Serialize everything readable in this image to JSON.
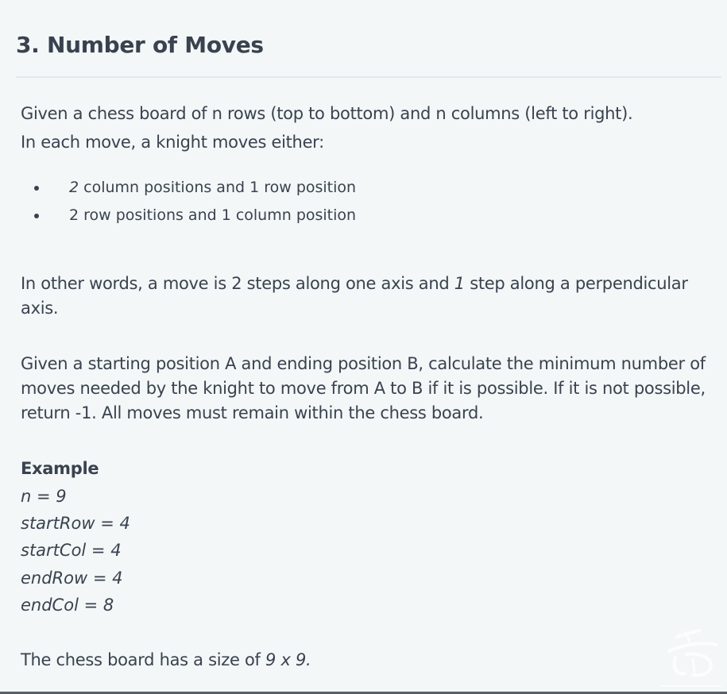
{
  "title": "3. Number of Moves",
  "intro": {
    "line1": "Given a chess board of n rows (top to bottom) and n columns (left to right).",
    "line2": "In each move, a knight moves either:"
  },
  "bullets": [
    {
      "lead": "2",
      "rest": " column positions and 1 row position"
    },
    {
      "lead": "",
      "rest": "2 row positions and 1 column position"
    }
  ],
  "other_words": {
    "before": "In other words, a move is 2 steps along one axis and ",
    "italic": "1",
    "after": " step along a perpendicular axis."
  },
  "task": "Given a starting position A and ending position B, calculate the minimum number of moves needed by the knight to move from A to B if it is possible. If it is not possible, return -1. All moves must remain within the chess board.",
  "example": {
    "heading": "Example",
    "lines": [
      "n = 9",
      "startRow = 4",
      "startCol = 4",
      "endRow = 4",
      "endCol = 8"
    ]
  },
  "board_size": {
    "before": "The chess board has a size of  ",
    "italic": "9 x 9."
  },
  "watermark_icon": "brush-stamp-icon"
}
